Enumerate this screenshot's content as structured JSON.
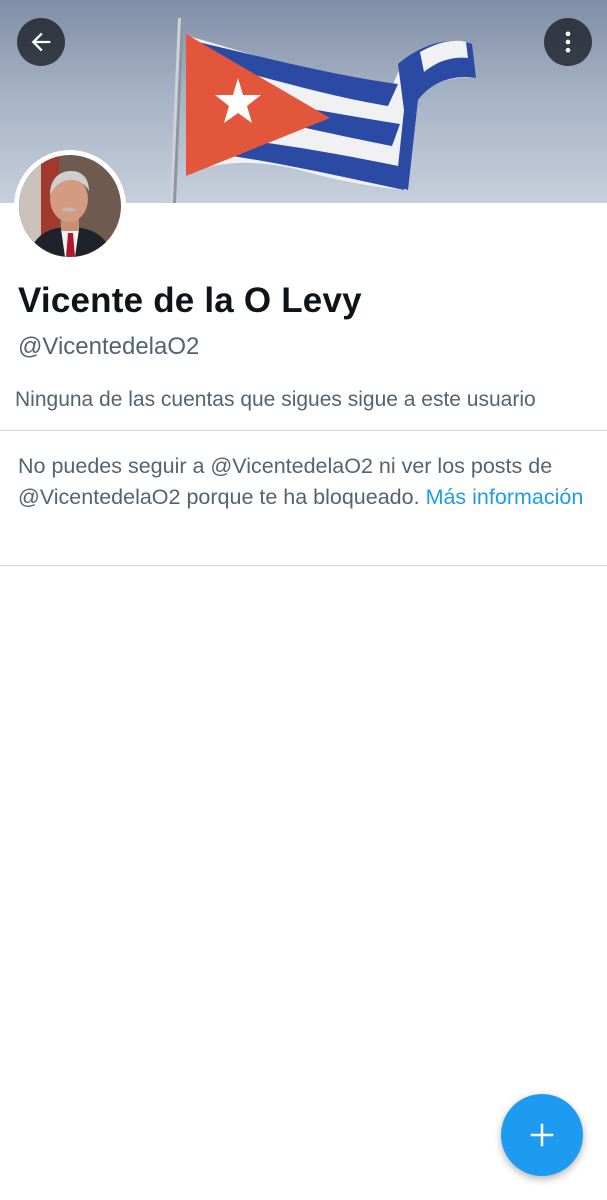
{
  "profile": {
    "display_name": "Vicente de la O Levy",
    "handle": "@VicentedelaO2",
    "followers_note": "Ninguna de las cuentas que sigues sigue a este usuario"
  },
  "blocked": {
    "message": "No puedes seguir a @VicentedelaO2 ni ver los posts de @VicentedelaO2 porque te ha bloqueado.",
    "link_label": "Más información"
  },
  "icons": {
    "back": "arrow-left-icon",
    "more": "more-vertical-icon",
    "fab": "plus-icon"
  },
  "colors": {
    "accent": "#1d9bf0",
    "secondary_text": "#536471",
    "primary_text": "#0f1419",
    "divider": "#cfd9de"
  }
}
